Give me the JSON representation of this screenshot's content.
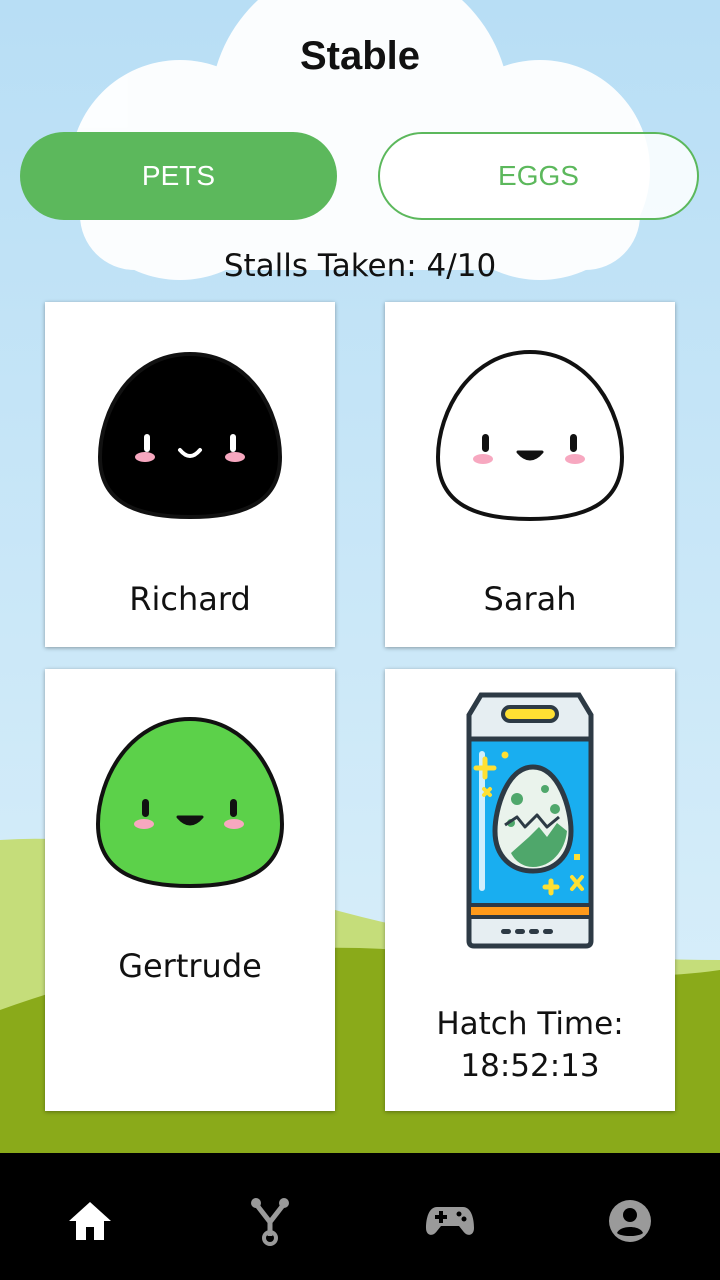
{
  "header": {
    "title": "Stable"
  },
  "tabs": [
    {
      "label": "PETS",
      "active": true
    },
    {
      "label": "EGGS",
      "active": false
    }
  ],
  "stalls": {
    "text": "Stalls Taken: 4/10"
  },
  "pets": [
    {
      "name": "Richard",
      "color": "#000000"
    },
    {
      "name": "Sarah",
      "color": "#ffffff"
    },
    {
      "name": "Gertrude",
      "color": "#5cd14a"
    }
  ],
  "egg": {
    "hatch_label": "Hatch Time:",
    "hatch_time": "18:52:13"
  },
  "nav": [
    {
      "icon": "home-icon",
      "active": true
    },
    {
      "icon": "tree-icon",
      "active": false
    },
    {
      "icon": "gamepad-icon",
      "active": false
    },
    {
      "icon": "profile-icon",
      "active": false
    }
  ],
  "colors": {
    "accent": "#5cb85c",
    "sky": "#c3e6f8",
    "grass": "#8aaa1a",
    "navbar": "#000000"
  }
}
